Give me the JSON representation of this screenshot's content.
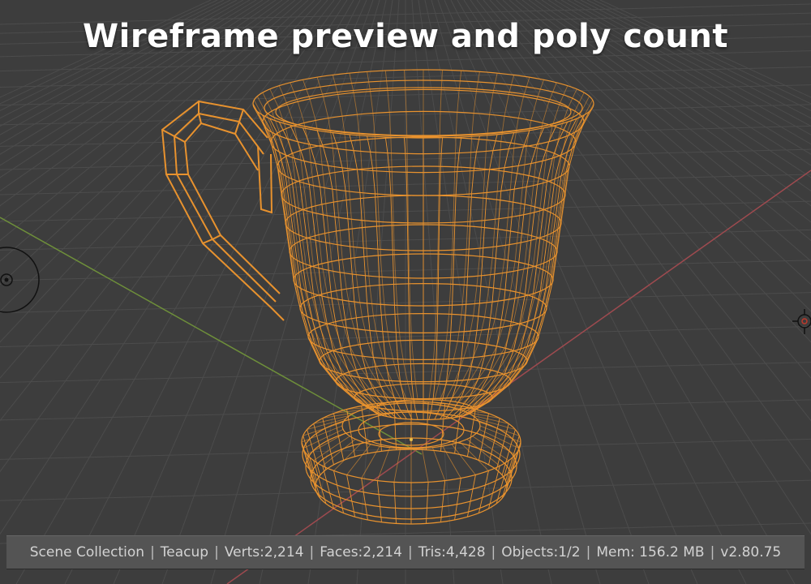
{
  "caption": "Wireframe preview and poly count",
  "colors": {
    "background": "#3d3d3d",
    "grid": "#4a4a4a",
    "x_axis": "#9e4a4f",
    "y_axis": "#6e8f3a",
    "wireframe": "#e8922e",
    "status_bar": "#545454"
  },
  "status_bar": {
    "collection": "Scene Collection",
    "object": "Teacup",
    "verts": "Verts:2,214",
    "faces": "Faces:2,214",
    "tris": "Tris:4,428",
    "objects": "Objects:1/2",
    "memory": "Mem: 156.2 MB",
    "version": "v2.80.75"
  },
  "icons": {
    "camera": "camera-icon",
    "light": "light-icon"
  }
}
